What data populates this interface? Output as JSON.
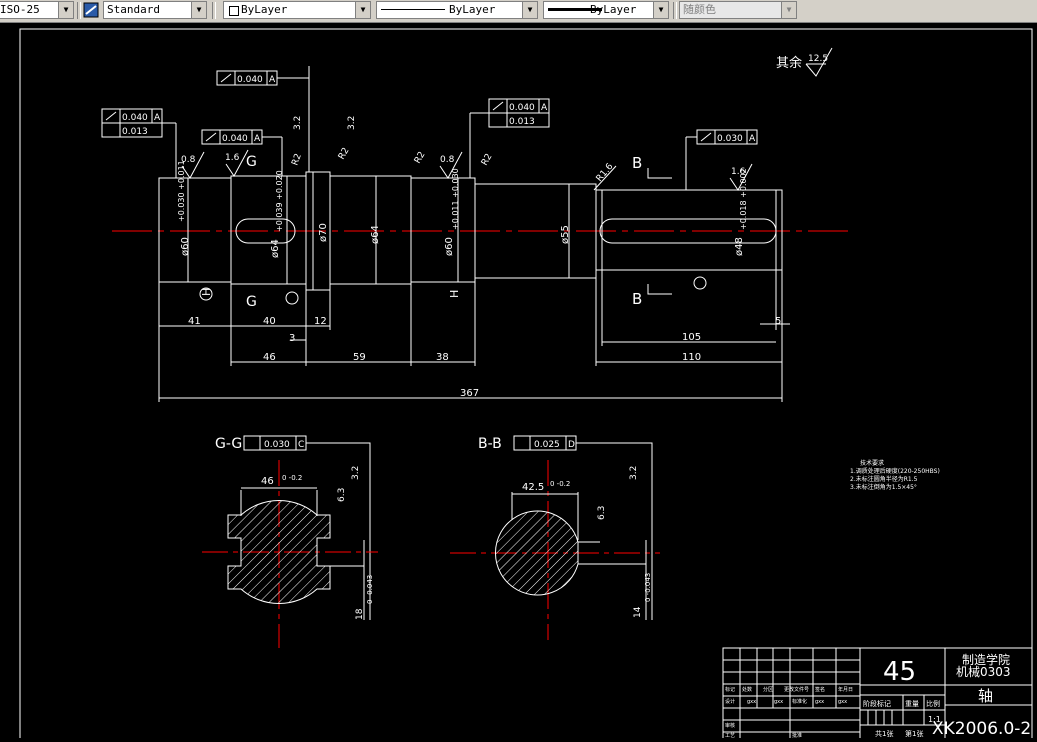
{
  "toolbar": {
    "dimstyle_value": "ISO-25",
    "textstyle_value": "Standard",
    "layer_value": "ByLayer",
    "linetype_value": "ByLayer",
    "lineweight_value": "ByLayer",
    "plotstyle_value": "随颜色"
  },
  "drawing": {
    "other_roughness_label": "其余",
    "other_roughness_value": "12.5",
    "tol_040": "0.040",
    "tol_013": "0.013",
    "tol_030": "0.030",
    "tol_025": "0.025",
    "datum_a": "A",
    "datum_c": "C",
    "datum_d": "D",
    "rough_08": "0.8",
    "rough_16": "1.6",
    "rough_32": "3.2",
    "rough_63": "6.3",
    "label_g": "G",
    "label_b": "B",
    "label_h": "H",
    "radius_r2": "R2",
    "radius_r16": "R1.6",
    "dia_60_a": "ø60",
    "tol_60_a": "+0.030 +0.011",
    "dia_64": "ø64",
    "tol_64": "+0.039 +0.020",
    "dia_70": "ø70",
    "dia_64b": "ø64",
    "dia_60_b": "ø60",
    "tol_60_b": "+0.011 +0.030",
    "dia_55": "ø55",
    "dia_48": "ø48",
    "tol_48": "+0.018 +0.002",
    "dim_41": "41",
    "dim_40": "40",
    "dim_12": "12",
    "dim_3": "3",
    "dim_46": "46",
    "dim_59": "59",
    "dim_38": "38",
    "dim_105": "105",
    "dim_5": "5",
    "dim_110": "110",
    "dim_367": "367",
    "section_gg_label": "G-G",
    "section_bb_label": "B-B",
    "sec_gg_46": "46",
    "sec_gg_46_tol": "0 -0.2",
    "sec_gg_18": "18",
    "sec_gg_18_tol": "0 -0.043",
    "sec_bb_425": "42.5",
    "sec_bb_425_tol": "0 -0.2",
    "sec_bb_14": "14",
    "sec_bb_14_tol": "0 -0.043",
    "notes_title": "技术要求",
    "notes": [
      "1.调质处理后硬度(220-250HBS)",
      "2.未标注圆角半径为R1.5",
      "3.未标注倒角为1.5×45°"
    ]
  },
  "title_block": {
    "material": "45",
    "school": "制造学院",
    "class": "机械0303",
    "part_name": "轴",
    "drawing_no": "XK2006.0-2",
    "stage_label": "阶段标记",
    "weight_label": "重量",
    "scale_label": "比例",
    "scale_value": "1:1",
    "sheets_total": "共1张",
    "sheet_no": "第1张",
    "row_labels": [
      "标记",
      "处数",
      "分区",
      "更改文件号",
      "签名",
      "年月日"
    ],
    "design_label": "设计",
    "review_label": "审核",
    "process_label": "工艺",
    "std_label": "标准化",
    "approve_label": "批准",
    "sign_a": "gxx",
    "sign_b": "gxx"
  },
  "colors": {
    "background": "#000000",
    "lines": "#ffffff",
    "centerline": "#ff0000",
    "toolbar": "#d4d0c8"
  }
}
